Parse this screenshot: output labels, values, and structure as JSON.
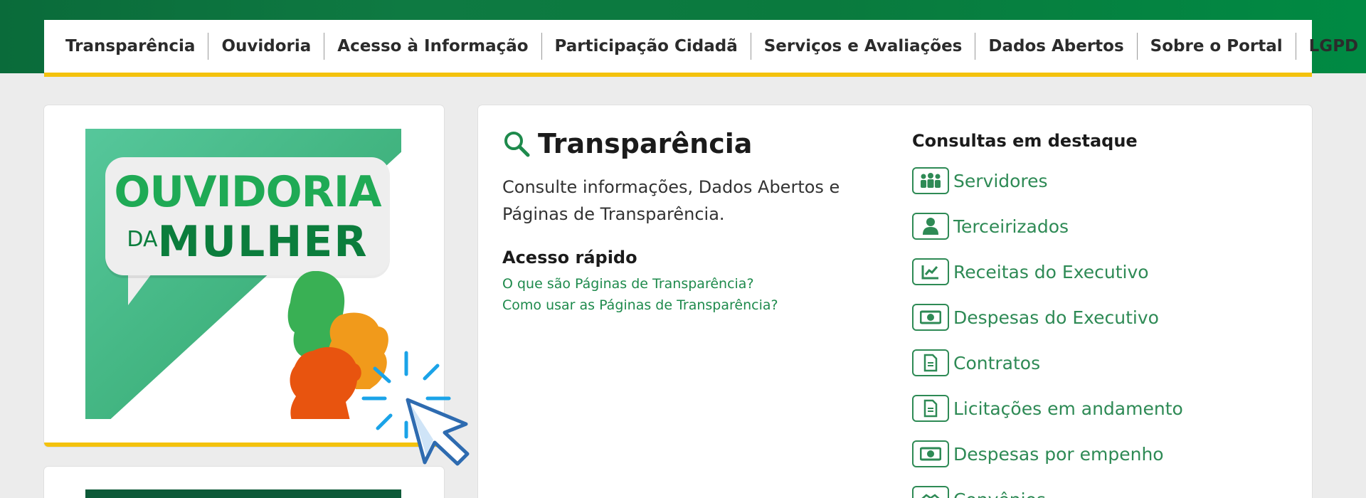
{
  "nav": {
    "items": [
      "Transparência",
      "Ouvidoria",
      "Acesso à Informação",
      "Participação Cidadã",
      "Serviços e Avaliações",
      "Dados Abertos",
      "Sobre o Portal",
      "LGPD"
    ]
  },
  "banner": {
    "line1": "OUVIDORIA",
    "line2_small": "DA",
    "line2_big": "MULHER"
  },
  "transparencia": {
    "title": "Transparência",
    "description": "Consulte informações, Dados Abertos e Páginas de Transparência.",
    "quick_title": "Acesso rápido",
    "links": [
      "O que são Páginas de Transparência?",
      "Como usar as Páginas de Transparência?"
    ]
  },
  "consultas": {
    "title": "Consultas em destaque",
    "items": [
      {
        "label": "Servidores",
        "icon": "people-group-icon"
      },
      {
        "label": "Terceirizados",
        "icon": "person-icon"
      },
      {
        "label": "Receitas do Executivo",
        "icon": "chart-line-icon"
      },
      {
        "label": "Despesas do Executivo",
        "icon": "money-bill-icon"
      },
      {
        "label": "Contratos",
        "icon": "document-icon"
      },
      {
        "label": "Licitações em andamento",
        "icon": "document-icon"
      },
      {
        "label": "Despesas por empenho",
        "icon": "money-bill-icon"
      },
      {
        "label": "Convênios",
        "icon": "handshake-icon"
      }
    ]
  },
  "colors": {
    "brand_green": "#0a7a3e",
    "accent_yellow": "#f4c20d",
    "link_green": "#2e8a55"
  }
}
